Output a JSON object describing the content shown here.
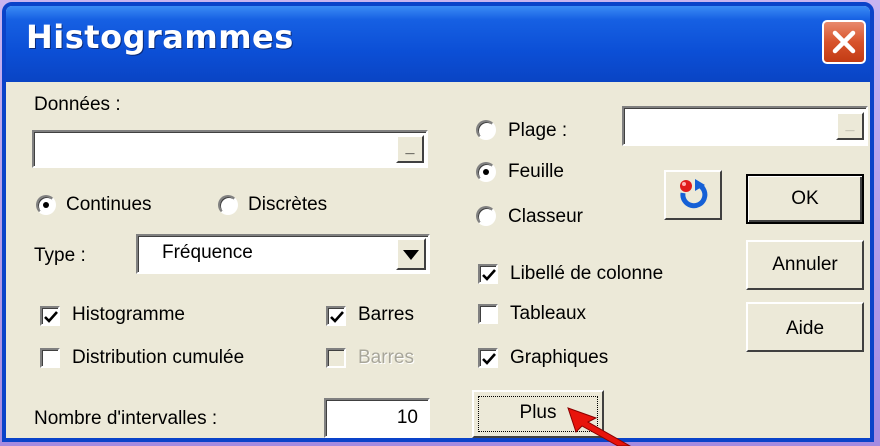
{
  "window": {
    "title": "Histogrammes"
  },
  "data_section": {
    "label": "Données :",
    "value": ""
  },
  "data_kind": {
    "options": [
      {
        "label": "Continues",
        "selected": true
      },
      {
        "label": "Discrètes",
        "selected": false
      }
    ]
  },
  "type": {
    "label": "Type :",
    "value": "Fréquence"
  },
  "checks": {
    "histogramme": {
      "label": "Histogramme",
      "checked": true
    },
    "barres1": {
      "label": "Barres",
      "checked": true
    },
    "distribution": {
      "label": "Distribution cumulée",
      "checked": false
    },
    "barres2": {
      "label": "Barres",
      "checked": false,
      "disabled": true
    }
  },
  "intervals": {
    "label": "Nombre d'intervalles :",
    "value": "10"
  },
  "output": {
    "options": [
      {
        "label": "Plage :",
        "selected": false
      },
      {
        "label": "Feuille",
        "selected": true
      },
      {
        "label": "Classeur",
        "selected": false
      }
    ],
    "range_value": ""
  },
  "options": {
    "libelle": {
      "label": "Libellé de colonne",
      "checked": true
    },
    "tableaux": {
      "label": "Tableaux",
      "checked": false
    },
    "graphiques": {
      "label": "Graphiques",
      "checked": true
    }
  },
  "buttons": {
    "ok": "OK",
    "annuler": "Annuler",
    "aide": "Aide",
    "plus": "Plus",
    "ellipsis": "_",
    "refresh_icon": "refresh-icon",
    "close_icon": "close-icon"
  },
  "colors": {
    "titlebar": "#0c4fd6",
    "close": "#d8532b",
    "dialog_bg": "#ece9d8",
    "arrow": "#e8140c"
  }
}
